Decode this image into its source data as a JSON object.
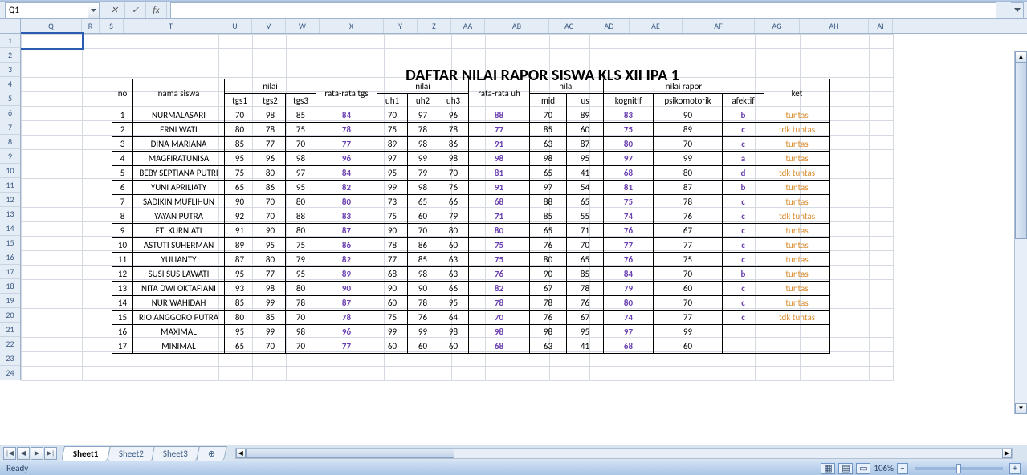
{
  "namebox": {
    "ref": "Q1",
    "fx_label": "fx"
  },
  "columns": [
    "Q",
    "R",
    "S",
    "T",
    "U",
    "V",
    "W",
    "X",
    "Y",
    "Z",
    "AA",
    "AB",
    "AC",
    "AD",
    "AE",
    "AF",
    "AG",
    "AH",
    "AI"
  ],
  "col_classes": [
    "cQ",
    "cR",
    "cS",
    "cT",
    "cU",
    "cV",
    "cW",
    "cX",
    "cY",
    "cZ",
    "cAA",
    "cAB",
    "cAC",
    "cAD",
    "cAE",
    "cAF",
    "cAG",
    "cAH",
    "cAI"
  ],
  "row_numbers": [
    1,
    2,
    3,
    4,
    5,
    6,
    7,
    8,
    9,
    10,
    11,
    12,
    13,
    14,
    15,
    16,
    17,
    18,
    19,
    20,
    21,
    22,
    23,
    24
  ],
  "title": "DAFTAR NILAI RAPOR SISWA KLS XII IPA 1",
  "headers": {
    "no": "no",
    "nama": "nama siswa",
    "nilai1": "nilai",
    "rata_tgs": "rata-rata tgs",
    "nilai2": "nilai",
    "rata_uh": "rata-rata uh",
    "nilai3": "nilai",
    "rapor": "nilai rapor",
    "ket": "ket",
    "tgs1": "tgs1",
    "tgs2": "tgs2",
    "tgs3": "tgs3",
    "uh1": "uh1",
    "uh2": "uh2",
    "uh3": "uh3",
    "mid": "mid",
    "us": "us",
    "kognitif": "kognitif",
    "psikomotorik": "psikomotorik",
    "afektif": "afektif"
  },
  "rows": [
    {
      "no": 1,
      "nama": "NURMALASARI",
      "tgs1": 70,
      "tgs2": 98,
      "tgs3": 85,
      "rtgs": 84,
      "uh1": 70,
      "uh2": 97,
      "uh3": 96,
      "ruh": 88,
      "mid": 70,
      "us": 89,
      "kog": 83,
      "psi": 90,
      "af": "b",
      "ket": "tuntas"
    },
    {
      "no": 2,
      "nama": "ERNI WATI",
      "tgs1": 80,
      "tgs2": 78,
      "tgs3": 75,
      "rtgs": 78,
      "uh1": 75,
      "uh2": 78,
      "uh3": 78,
      "ruh": 77,
      "mid": 85,
      "us": 60,
      "kog": 75,
      "psi": 89,
      "af": "c",
      "ket": "tdk tuntas"
    },
    {
      "no": 3,
      "nama": "DINA MARIANA",
      "tgs1": 85,
      "tgs2": 77,
      "tgs3": 70,
      "rtgs": 77,
      "uh1": 89,
      "uh2": 98,
      "uh3": 86,
      "ruh": 91,
      "mid": 63,
      "us": 87,
      "kog": 80,
      "psi": 70,
      "af": "c",
      "ket": "tuntas"
    },
    {
      "no": 4,
      "nama": "MAGFIRATUNISA",
      "tgs1": 95,
      "tgs2": 96,
      "tgs3": 98,
      "rtgs": 96,
      "uh1": 97,
      "uh2": 99,
      "uh3": 98,
      "ruh": 98,
      "mid": 98,
      "us": 95,
      "kog": 97,
      "psi": 99,
      "af": "a",
      "ket": "tuntas"
    },
    {
      "no": 5,
      "nama": "BEBY SEPTIANA PUTRI",
      "tgs1": 75,
      "tgs2": 80,
      "tgs3": 97,
      "rtgs": 84,
      "uh1": 95,
      "uh2": 79,
      "uh3": 70,
      "ruh": 81,
      "mid": 65,
      "us": 41,
      "kog": 68,
      "psi": 80,
      "af": "d",
      "ket": "tdk tuntas"
    },
    {
      "no": 6,
      "nama": "YUNI APRILIATY",
      "tgs1": 65,
      "tgs2": 86,
      "tgs3": 95,
      "rtgs": 82,
      "uh1": 99,
      "uh2": 98,
      "uh3": 76,
      "ruh": 91,
      "mid": 97,
      "us": 54,
      "kog": 81,
      "psi": 87,
      "af": "b",
      "ket": "tuntas"
    },
    {
      "no": 7,
      "nama": "SADIKIN MUFLIHUN",
      "tgs1": 90,
      "tgs2": 70,
      "tgs3": 80,
      "rtgs": 80,
      "uh1": 73,
      "uh2": 65,
      "uh3": 66,
      "ruh": 68,
      "mid": 88,
      "us": 65,
      "kog": 75,
      "psi": 78,
      "af": "c",
      "ket": "tuntas"
    },
    {
      "no": 8,
      "nama": "YAYAN PUTRA",
      "tgs1": 92,
      "tgs2": 70,
      "tgs3": 88,
      "rtgs": 83,
      "uh1": 75,
      "uh2": 60,
      "uh3": 79,
      "ruh": 71,
      "mid": 85,
      "us": 55,
      "kog": 74,
      "psi": 76,
      "af": "c",
      "ket": "tdk tuntas"
    },
    {
      "no": 9,
      "nama": "ETI KURNIATI",
      "tgs1": 91,
      "tgs2": 90,
      "tgs3": 80,
      "rtgs": 87,
      "uh1": 90,
      "uh2": 70,
      "uh3": 80,
      "ruh": 80,
      "mid": 65,
      "us": 71,
      "kog": 76,
      "psi": 67,
      "af": "c",
      "ket": "tuntas"
    },
    {
      "no": 10,
      "nama": "ASTUTI SUHERMAN",
      "tgs1": 89,
      "tgs2": 95,
      "tgs3": 75,
      "rtgs": 86,
      "uh1": 78,
      "uh2": 86,
      "uh3": 60,
      "ruh": 75,
      "mid": 76,
      "us": 70,
      "kog": 77,
      "psi": 77,
      "af": "c",
      "ket": "tuntas"
    },
    {
      "no": 11,
      "nama": "YULIANTY",
      "tgs1": 87,
      "tgs2": 80,
      "tgs3": 79,
      "rtgs": 82,
      "uh1": 77,
      "uh2": 85,
      "uh3": 63,
      "ruh": 75,
      "mid": 80,
      "us": 65,
      "kog": 76,
      "psi": 75,
      "af": "c",
      "ket": "tuntas"
    },
    {
      "no": 12,
      "nama": "SUSI SUSILAWATI",
      "tgs1": 95,
      "tgs2": 77,
      "tgs3": 95,
      "rtgs": 89,
      "uh1": 68,
      "uh2": 98,
      "uh3": 63,
      "ruh": 76,
      "mid": 90,
      "us": 85,
      "kog": 84,
      "psi": 70,
      "af": "b",
      "ket": "tuntas"
    },
    {
      "no": 13,
      "nama": "NITA DWI OKTAFIANI",
      "tgs1": 93,
      "tgs2": 98,
      "tgs3": 80,
      "rtgs": 90,
      "uh1": 90,
      "uh2": 90,
      "uh3": 66,
      "ruh": 82,
      "mid": 67,
      "us": 78,
      "kog": 79,
      "psi": 60,
      "af": "c",
      "ket": "tuntas"
    },
    {
      "no": 14,
      "nama": "NUR WAHIDAH",
      "tgs1": 85,
      "tgs2": 99,
      "tgs3": 78,
      "rtgs": 87,
      "uh1": 60,
      "uh2": 78,
      "uh3": 95,
      "ruh": 78,
      "mid": 78,
      "us": 76,
      "kog": 80,
      "psi": 70,
      "af": "c",
      "ket": "tuntas"
    },
    {
      "no": 15,
      "nama": "RIO ANGGORO PUTRA",
      "tgs1": 80,
      "tgs2": 85,
      "tgs3": 70,
      "rtgs": 78,
      "uh1": 75,
      "uh2": 76,
      "uh3": 64,
      "ruh": 70,
      "mid": 76,
      "us": 67,
      "kog": 74,
      "psi": 77,
      "af": "c",
      "ket": "tdk tuntas"
    },
    {
      "no": 16,
      "nama": "MAXIMAL",
      "tgs1": 95,
      "tgs2": 99,
      "tgs3": 98,
      "rtgs": 96,
      "uh1": 99,
      "uh2": 99,
      "uh3": 98,
      "ruh": 98,
      "mid": 98,
      "us": 95,
      "kog": 97,
      "psi": 99,
      "af": "",
      "ket": ""
    },
    {
      "no": 17,
      "nama": "MINIMAL",
      "tgs1": 65,
      "tgs2": 70,
      "tgs3": 70,
      "rtgs": 77,
      "uh1": 60,
      "uh2": 60,
      "uh3": 60,
      "ruh": 68,
      "mid": 63,
      "us": 41,
      "kog": 68,
      "psi": 60,
      "af": "",
      "ket": ""
    }
  ],
  "tabs": [
    "Sheet1",
    "Sheet2",
    "Sheet3"
  ],
  "active_tab": 0,
  "status": {
    "ready": "Ready",
    "zoom": "106%"
  },
  "chart_data": {
    "type": "table",
    "title": "DAFTAR NILAI RAPOR SISWA KLS XII IPA 1",
    "columns": [
      "no",
      "nama siswa",
      "tgs1",
      "tgs2",
      "tgs3",
      "rata-rata tgs",
      "uh1",
      "uh2",
      "uh3",
      "rata-rata uh",
      "mid",
      "us",
      "kognitif",
      "psikomotorik",
      "afektif",
      "ket"
    ]
  }
}
